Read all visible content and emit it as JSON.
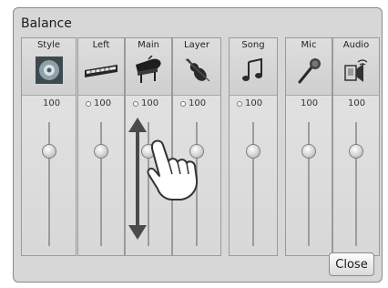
{
  "panel": {
    "title": "Balance",
    "close_label": "Close"
  },
  "channels": [
    {
      "name": "Style",
      "value": "100",
      "icon": "speaker-icon",
      "level": 0.5,
      "indicator": false
    },
    {
      "name": "Left",
      "value": "100",
      "icon": "keyboard-icon",
      "level": 0.5,
      "indicator": true
    },
    {
      "name": "Main",
      "value": "100",
      "icon": "grand-piano-icon",
      "level": 0.5,
      "indicator": true
    },
    {
      "name": "Layer",
      "value": "100",
      "icon": "violin-icon",
      "level": 0.5,
      "indicator": true
    },
    {
      "name": "Song",
      "value": "100",
      "icon": "music-note-icon",
      "level": 0.5,
      "indicator": true
    },
    {
      "name": "Mic",
      "value": "100",
      "icon": "microphone-icon",
      "level": 0.5,
      "indicator": false
    },
    {
      "name": "Audio",
      "value": "100",
      "icon": "audio-device-icon",
      "level": 0.5,
      "indicator": false
    }
  ],
  "overlay": {
    "arrow_icon": "up-down-arrow-icon",
    "hand_icon": "touch-hand-icon"
  }
}
